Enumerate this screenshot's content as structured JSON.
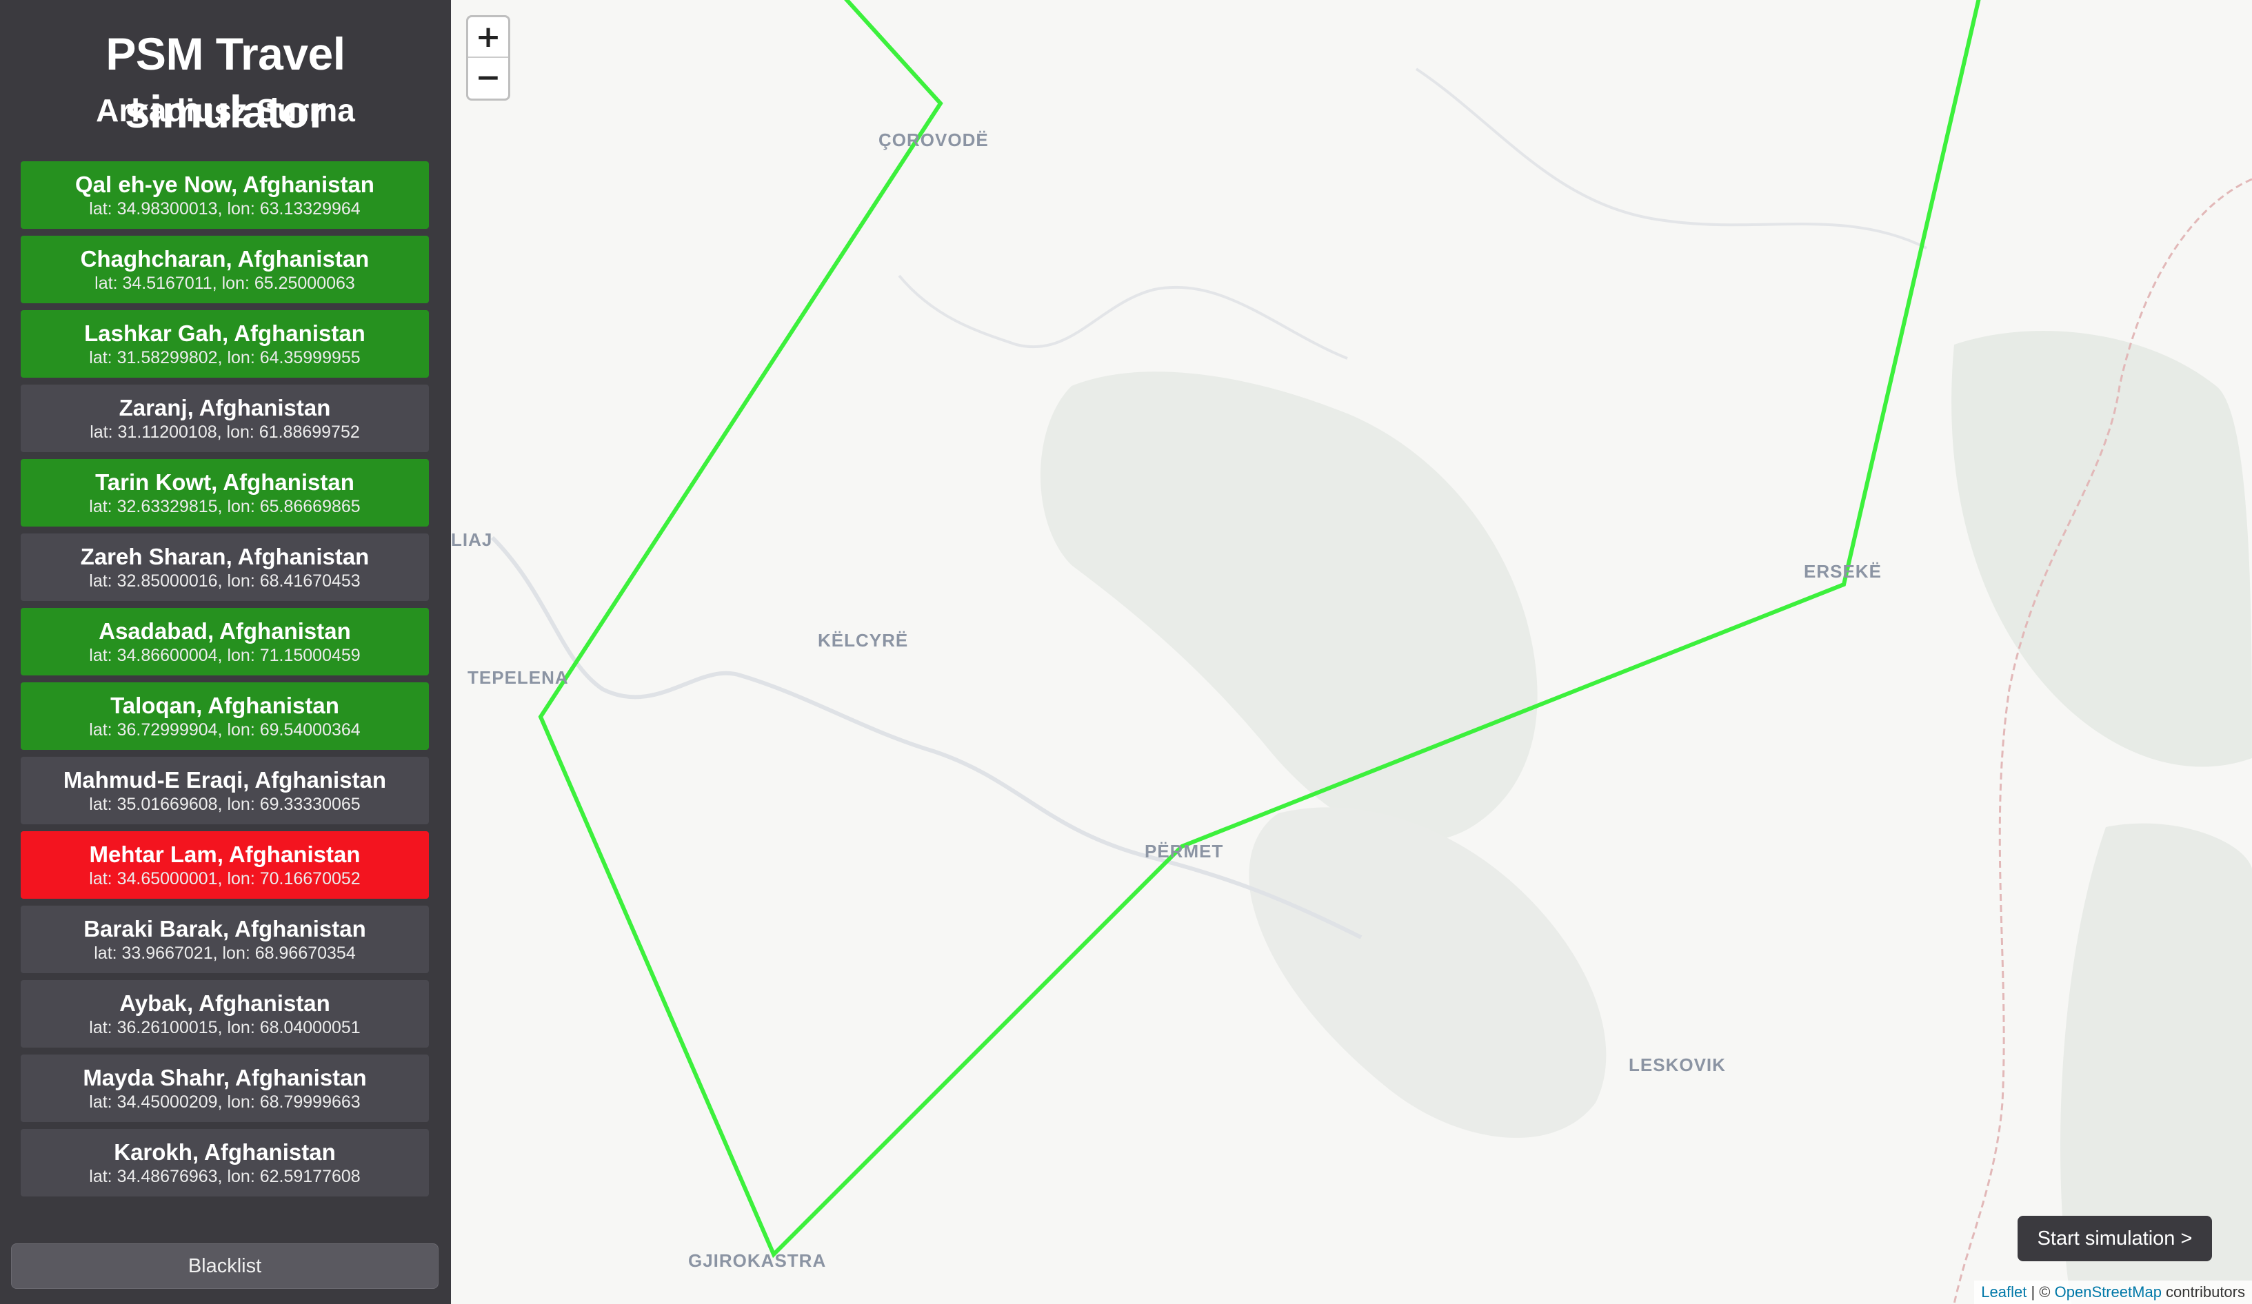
{
  "sidebar": {
    "title": "PSM Travel simulator",
    "subtitle": "Arkadiusz Surma",
    "cities": [
      {
        "name": "Qal eh-ye Now, Afghanistan",
        "coords": "lat: 34.98300013, lon: 63.13329964",
        "status": "visited"
      },
      {
        "name": "Chaghcharan, Afghanistan",
        "coords": "lat: 34.5167011, lon: 65.25000063",
        "status": "visited"
      },
      {
        "name": "Lashkar Gah, Afghanistan",
        "coords": "lat: 31.58299802, lon: 64.35999955",
        "status": "visited"
      },
      {
        "name": "Zaranj, Afghanistan",
        "coords": "lat: 31.11200108, lon: 61.88699752",
        "status": "default"
      },
      {
        "name": "Tarin Kowt, Afghanistan",
        "coords": "lat: 32.63329815, lon: 65.86669865",
        "status": "visited"
      },
      {
        "name": "Zareh Sharan, Afghanistan",
        "coords": "lat: 32.85000016, lon: 68.41670453",
        "status": "default"
      },
      {
        "name": "Asadabad, Afghanistan",
        "coords": "lat: 34.86600004, lon: 71.15000459",
        "status": "visited"
      },
      {
        "name": "Taloqan, Afghanistan",
        "coords": "lat: 36.72999904, lon: 69.54000364",
        "status": "visited"
      },
      {
        "name": "Mahmud-E Eraqi, Afghanistan",
        "coords": "lat: 35.01669608, lon: 69.33330065",
        "status": "default"
      },
      {
        "name": "Mehtar Lam, Afghanistan",
        "coords": "lat: 34.65000001, lon: 70.16670052",
        "status": "current"
      },
      {
        "name": "Baraki Barak, Afghanistan",
        "coords": "lat: 33.9667021, lon: 68.96670354",
        "status": "default"
      },
      {
        "name": "Aybak, Afghanistan",
        "coords": "lat: 36.26100015, lon: 68.04000051",
        "status": "default"
      },
      {
        "name": "Mayda Shahr, Afghanistan",
        "coords": "lat: 34.45000209, lon: 68.79999663",
        "status": "default"
      },
      {
        "name": "Karokh, Afghanistan",
        "coords": "lat: 34.48676963, lon: 62.59177608",
        "status": "default"
      }
    ],
    "blacklist_label": "Blacklist"
  },
  "map": {
    "zoom_in": "+",
    "zoom_out": "−",
    "labels": {
      "corovode": "ÇOROVODË",
      "liaj": "LIAJ",
      "kelcyre": "KËLCYRË",
      "tepelena": "TEPELENA",
      "permet": "PËRMET",
      "ersekë": "ERSEKË",
      "leskovik": "LESKOVIK",
      "gjirokastra": "GJIROKASTRA"
    },
    "route_color": "#3cf03c",
    "start_label": "Start simulation >",
    "attribution": {
      "leaflet": "Leaflet",
      "separator": " | © ",
      "osm": "OpenStreetMap",
      "suffix": " contributors"
    }
  },
  "colors": {
    "sidebar_bg": "#3b3a3f",
    "visited": "#26911f",
    "current": "#f3141f",
    "default": "#4a4950"
  }
}
